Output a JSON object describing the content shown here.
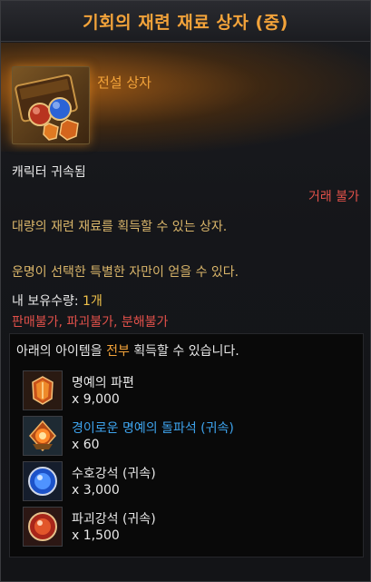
{
  "tooltip": {
    "title": "기회의 재련 재료 상자 (중)",
    "grade": "전설 상자",
    "bound": "캐릭터 귀속됨",
    "trade": "거래 불가",
    "description_1": "대량의 재련 재료를 획득할 수 있는 상자.",
    "description_2": "운명이 선택한 특별한 자만이 얻을 수 있다.",
    "owned_label": "내 보유수량: ",
    "owned_count": "1개",
    "restrictions": [
      "판매불가",
      "파괴불가",
      "분해불가"
    ],
    "restriction_separator": ", ",
    "rewards_prefix": "아래의 아이템을 ",
    "rewards_highlight": "전부",
    "rewards_suffix": " 획득할 수 있습니다.",
    "items": [
      {
        "name": "명예의 파편",
        "qty": "x 9,000",
        "icon": "honor-shard-icon"
      },
      {
        "name": "경이로운 명예의 돌파석 (귀속)",
        "qty": "x 60",
        "icon": "breakthrough-stone-icon"
      },
      {
        "name": "수호강석 (귀속)",
        "qty": "x 3,000",
        "icon": "guardian-stone-icon"
      },
      {
        "name": "파괴강석 (귀속)",
        "qty": "x 1,500",
        "icon": "destruction-stone-icon"
      }
    ]
  },
  "colors": {
    "gold": "#f3a33a",
    "red": "#e2514a",
    "blue": "#3ea4ee",
    "desc": "#d9b56a"
  }
}
